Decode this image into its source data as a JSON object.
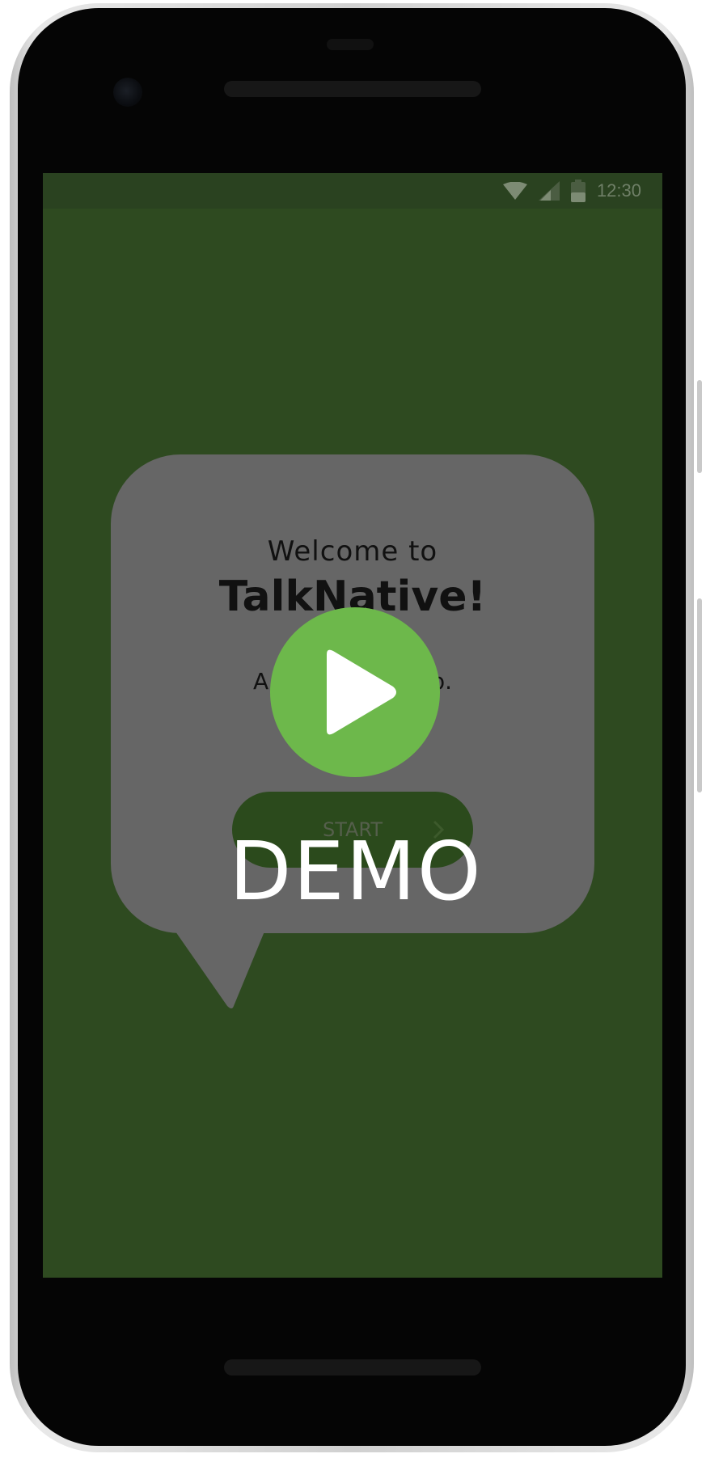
{
  "status_bar": {
    "time": "12:30",
    "icons": [
      "wifi-icon",
      "cellular-signal-icon",
      "battery-icon"
    ]
  },
  "welcome": {
    "line1": "Welcome to",
    "app_name": "TalkNative!",
    "tagline": "A more “                  ion app.",
    "start_label": "START"
  },
  "overlay": {
    "play_icon": "play-icon",
    "label": "DEMO"
  },
  "colors": {
    "screen_background": "#2e4a20",
    "bubble": "#666666",
    "play_button": "#6db84b",
    "start_button": "#2b4a1c"
  }
}
